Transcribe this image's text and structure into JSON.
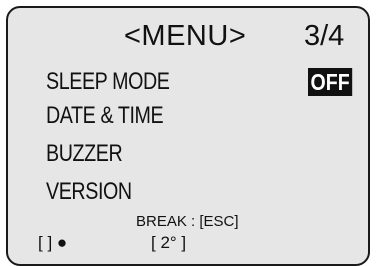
{
  "header": {
    "title": "<MENU>",
    "page_indicator": "3/4"
  },
  "menu": {
    "items": [
      {
        "label": "SLEEP MODE",
        "value": "OFF"
      },
      {
        "label": "DATE & TIME"
      },
      {
        "label": "BUZZER"
      },
      {
        "label": "VERSION"
      }
    ]
  },
  "footer": {
    "hint": "BREAK : [ESC]",
    "status_left": "[    ] ●",
    "status_right": "[ 2° ]"
  },
  "colors": {
    "screen_bg": "#e6e6e6",
    "text": "#111111",
    "highlight_bg": "#111111",
    "highlight_text": "#ffffff"
  }
}
